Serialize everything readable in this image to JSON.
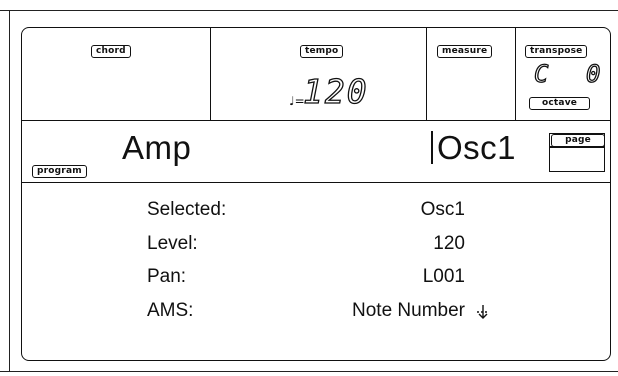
{
  "header": {
    "chord_label": "chord",
    "tempo_label": "tempo",
    "tempo_symbol": "♩=",
    "tempo_value": "120",
    "measure_label": "measure",
    "transpose_label": "transpose",
    "transpose_key": "C",
    "transpose_value": "0",
    "octave_label": "octave"
  },
  "program": {
    "program_label": "program",
    "name": "Amp",
    "page": "Osc1",
    "page_button_label": "page"
  },
  "params": [
    {
      "label": "Selected:",
      "value": "Osc1"
    },
    {
      "label": "Level:",
      "value": "120"
    },
    {
      "label": "Pan:",
      "value": "L001"
    },
    {
      "label": "AMS:",
      "value": "Note Number"
    }
  ],
  "icons": {
    "ams_arrow": "down-arrow-icon"
  }
}
